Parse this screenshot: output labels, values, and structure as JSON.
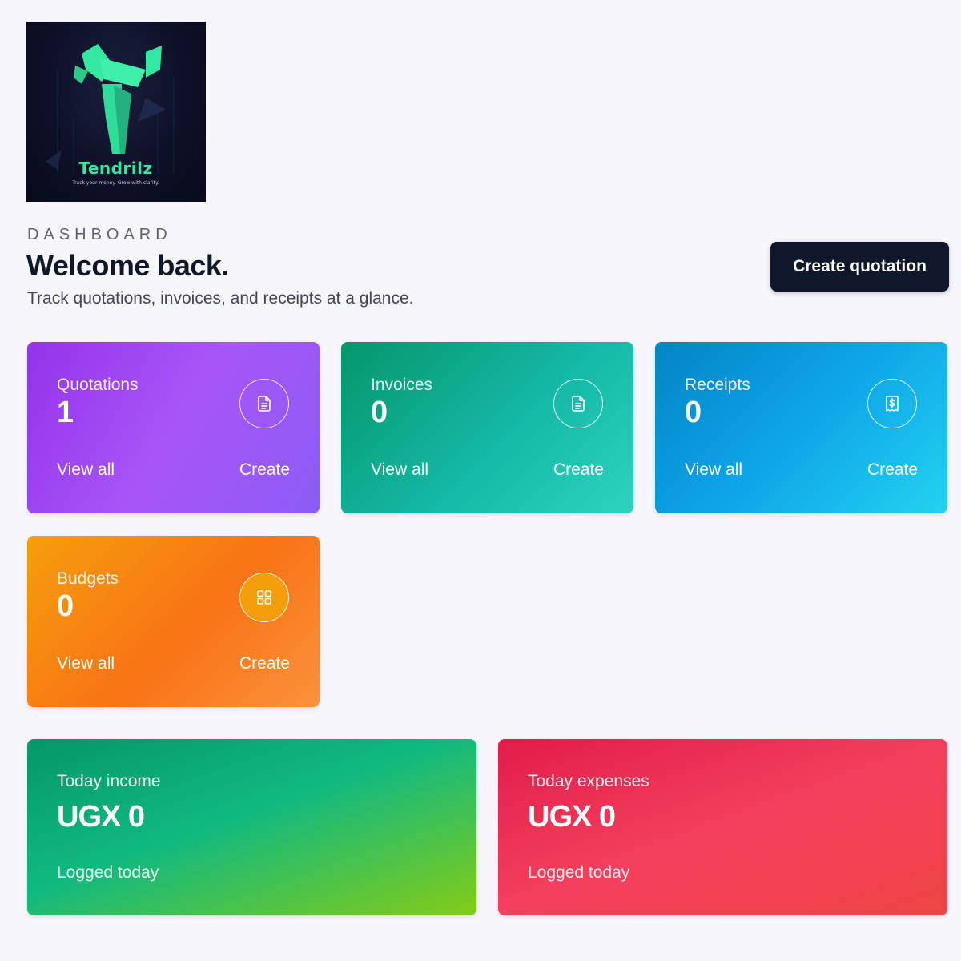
{
  "brand": {
    "name": "Tendrilz",
    "tagline": "Track your money. Grow with clarity."
  },
  "header": {
    "eyebrow": "DASHBOARD",
    "title": "Welcome back.",
    "subtitle": "Track quotations, invoices, and receipts at a glance.",
    "primary_action": "Create quotation"
  },
  "cards": [
    {
      "label": "Quotations",
      "count": "1",
      "view_label": "View all",
      "create_label": "Create",
      "icon": "document-icon",
      "color": "#a855f7"
    },
    {
      "label": "Invoices",
      "count": "0",
      "view_label": "View all",
      "create_label": "Create",
      "icon": "document-icon",
      "color": "#14b8a6"
    },
    {
      "label": "Receipts",
      "count": "0",
      "view_label": "View all",
      "create_label": "Create",
      "icon": "receipt-dollar-icon",
      "color": "#0ea5e9"
    },
    {
      "label": "Budgets",
      "count": "0",
      "view_label": "View all",
      "create_label": "Create",
      "icon": "grid-icon",
      "color": "#f97316"
    }
  ],
  "today": {
    "income": {
      "label": "Today income",
      "amount": "UGX 0",
      "note": "Logged today",
      "color": "#10b981"
    },
    "expenses": {
      "label": "Today expenses",
      "amount": "UGX 0",
      "note": "Logged today",
      "color": "#f43f5e"
    }
  }
}
